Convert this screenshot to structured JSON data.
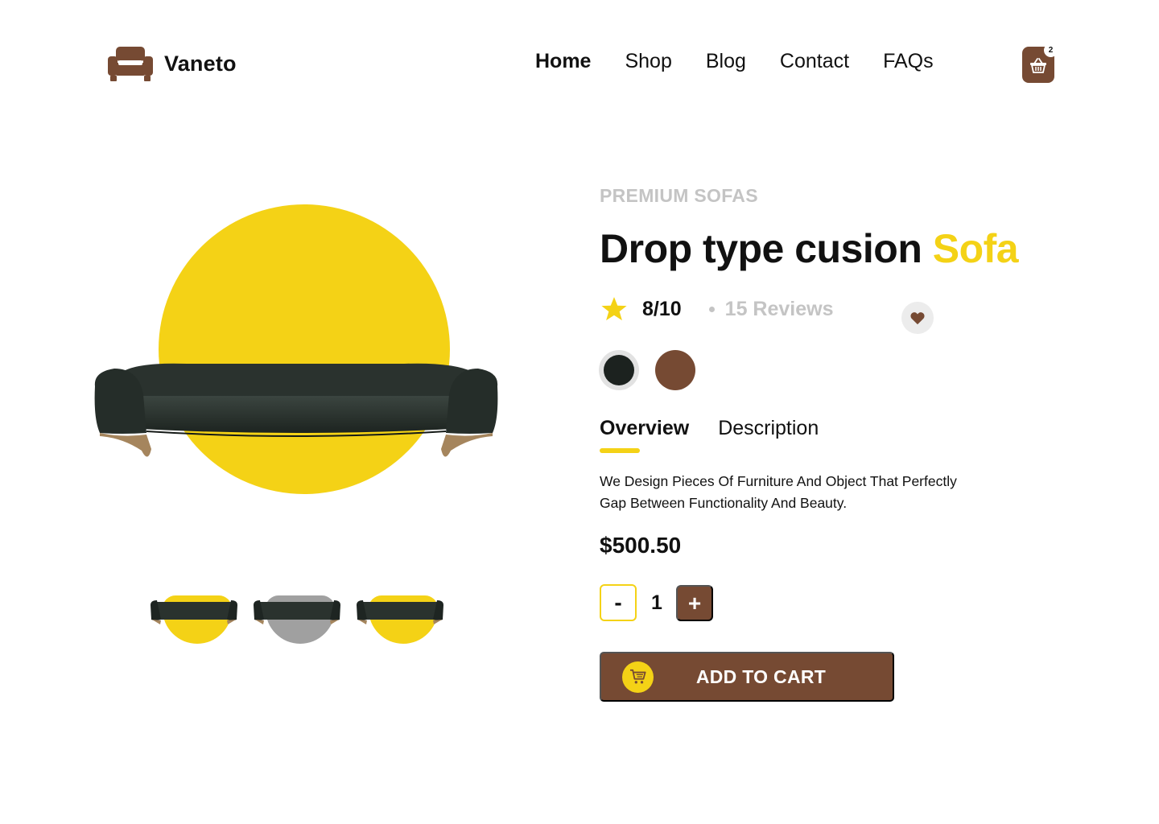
{
  "header": {
    "brand": "Vaneto",
    "nav": [
      {
        "label": "Home",
        "active": true
      },
      {
        "label": "Shop",
        "active": false
      },
      {
        "label": "Blog",
        "active": false
      },
      {
        "label": "Contact",
        "active": false
      },
      {
        "label": "FAQs",
        "active": false
      }
    ],
    "cart_count": "2"
  },
  "product": {
    "category": "PREMIUM SOFAS",
    "title_main": "Drop type cusion ",
    "title_accent": "Sofa",
    "rating": "8/10",
    "reviews": "15 Reviews",
    "colors": [
      "#1c221f",
      "#764a33"
    ],
    "tabs": [
      {
        "label": "Overview",
        "active": true
      },
      {
        "label": "Description",
        "active": false
      }
    ],
    "description": "We Design Pieces Of Furniture And Object That Perfectly Gap Between Functionality And Beauty.",
    "price": "$500.50",
    "quantity": "1",
    "qty_minus": "-",
    "qty_plus": "+",
    "add_to_cart": "ADD TO CART"
  },
  "gallery": {
    "thumbnail_backgrounds": [
      "yellow",
      "gray",
      "yellow"
    ]
  },
  "icons": {
    "logo": "armchair-icon",
    "cart": "basket-icon",
    "rating": "star-icon",
    "favorite": "heart-icon",
    "add_to_cart": "shopping-cart-icon"
  },
  "theme": {
    "accent": "#f4d216",
    "brand": "#764a33",
    "muted": "#c4c4c4"
  }
}
